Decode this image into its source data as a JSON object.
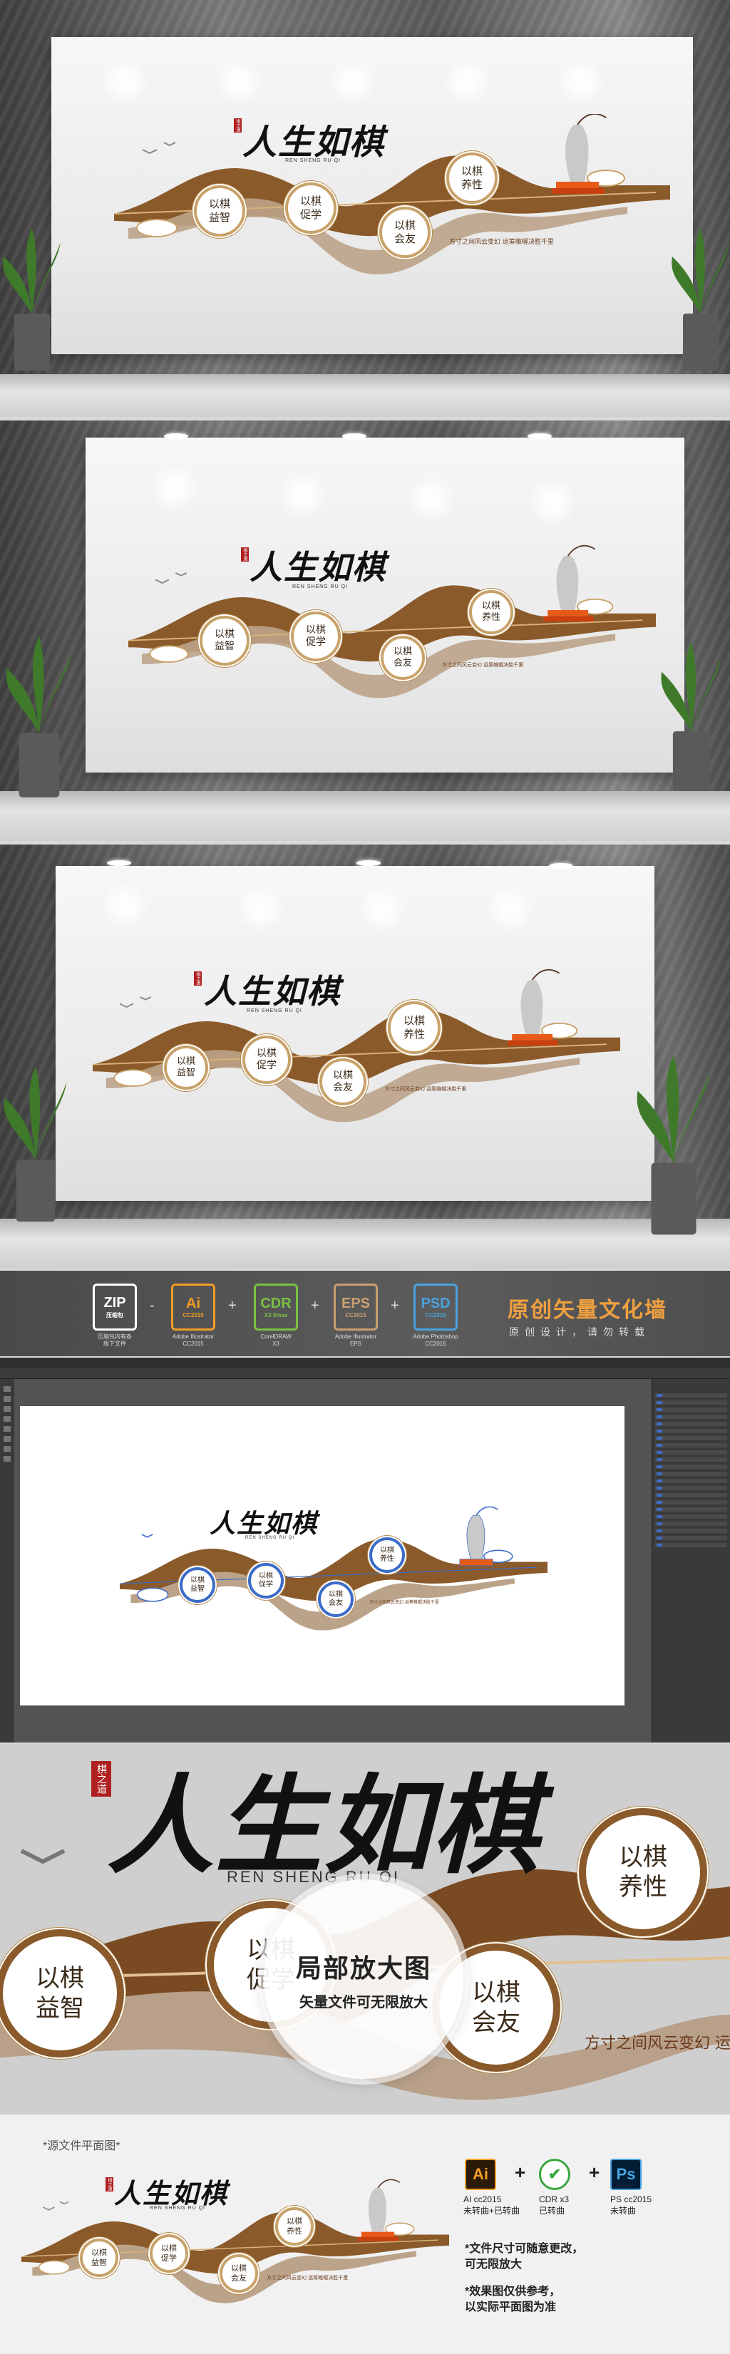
{
  "artwork": {
    "title": "人生如棋",
    "pinyin": "REN SHENG RU QI",
    "motto": "方寸之间风云变幻  运筹帷幄决胜千里",
    "seal": "棋之道",
    "values": [
      {
        "text": "以棋\n益智"
      },
      {
        "text": "以棋\n促学"
      },
      {
        "text": "以棋\n会友"
      },
      {
        "text": "以棋\n养性"
      }
    ]
  },
  "banner": {
    "formats": [
      {
        "big": "ZIP",
        "small": "压缩包",
        "caption": "压缩包内有各\n版下文件",
        "color": "#ffffff"
      },
      {
        "big": "Ai",
        "small": "CC2015",
        "caption": "Adobe Illustrator\nCC2015",
        "color": "#f29d25"
      },
      {
        "big": "CDR",
        "small": "X3 3mas",
        "caption": "CorelDRAW\nX3",
        "color": "#7cc142"
      },
      {
        "big": "EPS",
        "small": "CC2015",
        "caption": "Adobe Illustrator\nEPS",
        "color": "#c8a070"
      },
      {
        "big": "PSD",
        "small": "CC2015",
        "caption": "Adobe Photoshop\nCC2015",
        "color": "#4aa3e0"
      }
    ],
    "dash": "-",
    "plus": "+",
    "title": "原创矢量文化墙",
    "subtitle": "原创设计，请勿转载"
  },
  "zoom": {
    "lens_title": "局部放大图",
    "lens_subtitle": "矢量文件可无限放大",
    "motto_partial": "方寸之间风云变幻  运"
  },
  "footer": {
    "label": "*源文件平面图*",
    "software": [
      {
        "icon": "Ai",
        "caption": "AI cc2015\n未转曲+已转曲",
        "bg": "#2b1a05",
        "fg": "#f29d25"
      },
      {
        "icon": "✔",
        "caption": "CDR x3\n已转曲",
        "bg": "#ffffff",
        "fg": "#3aa640"
      },
      {
        "icon": "Ps",
        "caption": "PS cc2015\n未转曲",
        "bg": "#001d33",
        "fg": "#4aa3e0"
      }
    ],
    "plus": "+",
    "notes": [
      "*文件尺寸可随意更改，\n  可无限放大",
      "*效果图仅供参考，\n  以实际平面图为准"
    ]
  }
}
